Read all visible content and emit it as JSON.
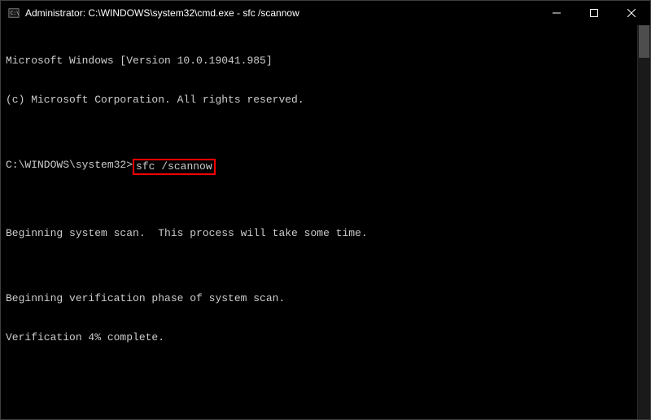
{
  "titlebar": {
    "title": "Administrator: C:\\WINDOWS\\system32\\cmd.exe - sfc  /scannow"
  },
  "terminal": {
    "line1": "Microsoft Windows [Version 10.0.19041.985]",
    "line2": "(c) Microsoft Corporation. All rights reserved.",
    "blank1": "",
    "prompt": "C:\\WINDOWS\\system32>",
    "command": "sfc /scannow",
    "blank2": "",
    "line3": "Beginning system scan.  This process will take some time.",
    "blank3": "",
    "line4": "Beginning verification phase of system scan.",
    "line5": "Verification 4% complete."
  }
}
